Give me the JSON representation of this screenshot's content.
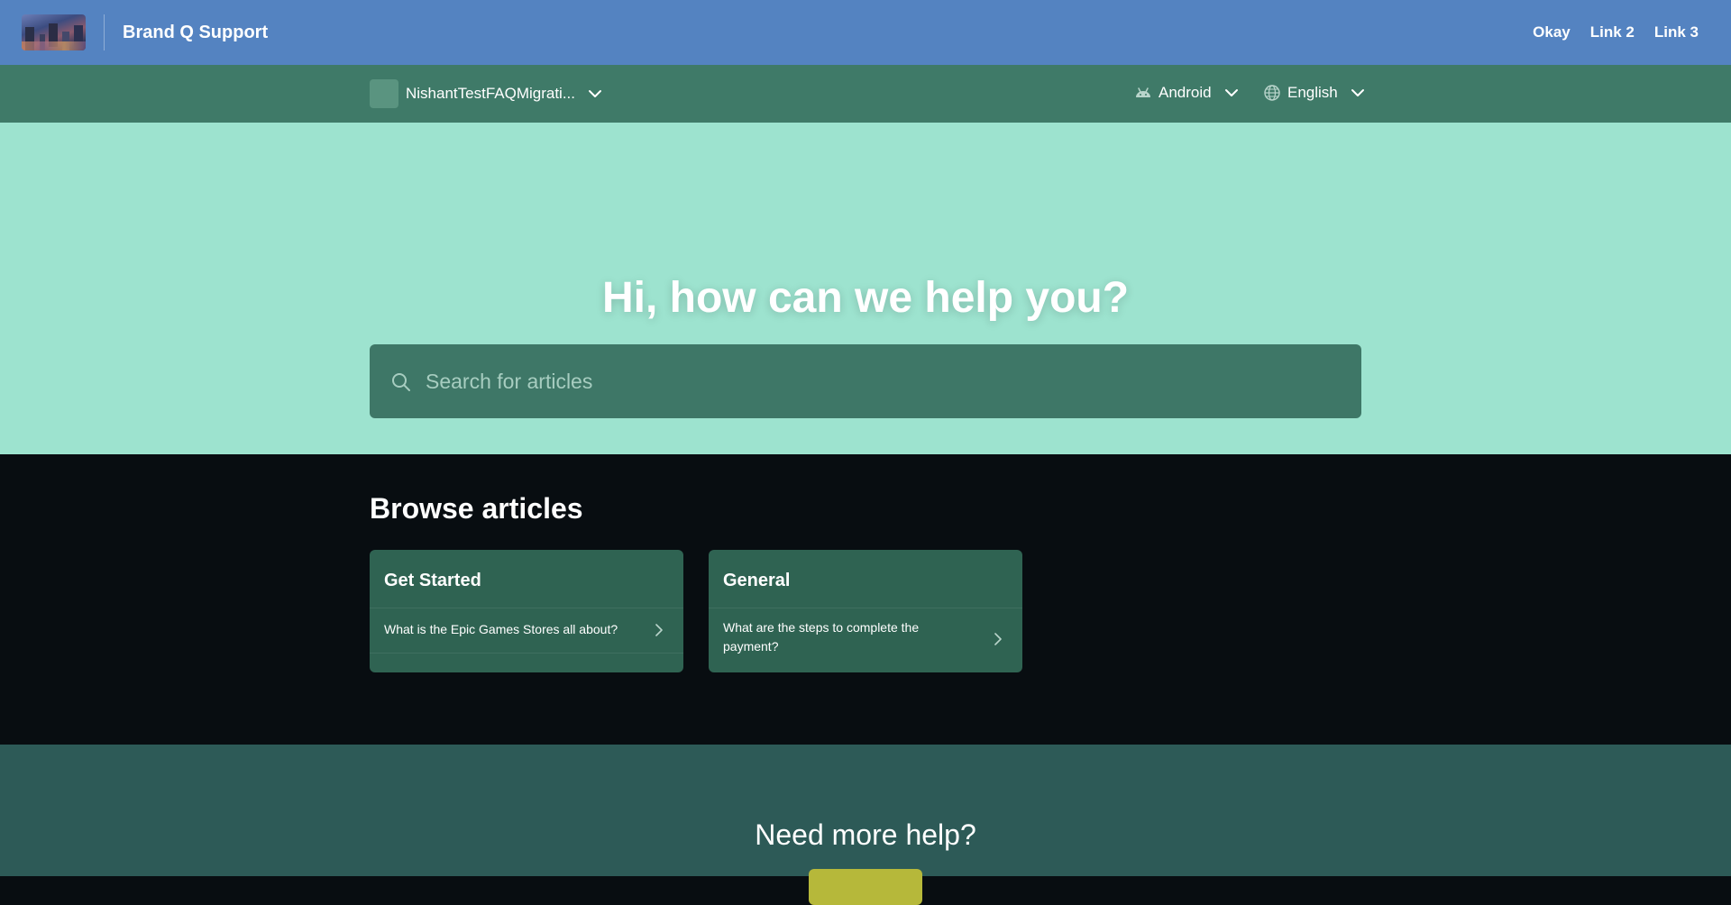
{
  "header": {
    "brand_title": "Brand Q Support",
    "links": [
      "Okay",
      "Link 2",
      "Link 3"
    ]
  },
  "subbar": {
    "app_name": "NishantTestFAQMigrati...",
    "platform": "Android",
    "language": "English"
  },
  "hero": {
    "title": "Hi, how can we help you?",
    "search_placeholder": "Search for articles"
  },
  "browse": {
    "title": "Browse articles",
    "categories": [
      {
        "title": "Get Started",
        "articles": [
          "What is the Epic Games Stores all about?"
        ]
      },
      {
        "title": "General",
        "articles": [
          "What are the steps to complete the payment?"
        ]
      }
    ]
  },
  "footer": {
    "title": "Need more help?"
  },
  "colors": {
    "topbar": "#5483c1",
    "subbar": "#3f7a68",
    "hero": "#9de3cf",
    "search_box": "#3e7767",
    "browse_bg": "#080d11",
    "card": "#2f6352",
    "footer": "#2d5a57",
    "contact_button": "#b6b83a"
  }
}
